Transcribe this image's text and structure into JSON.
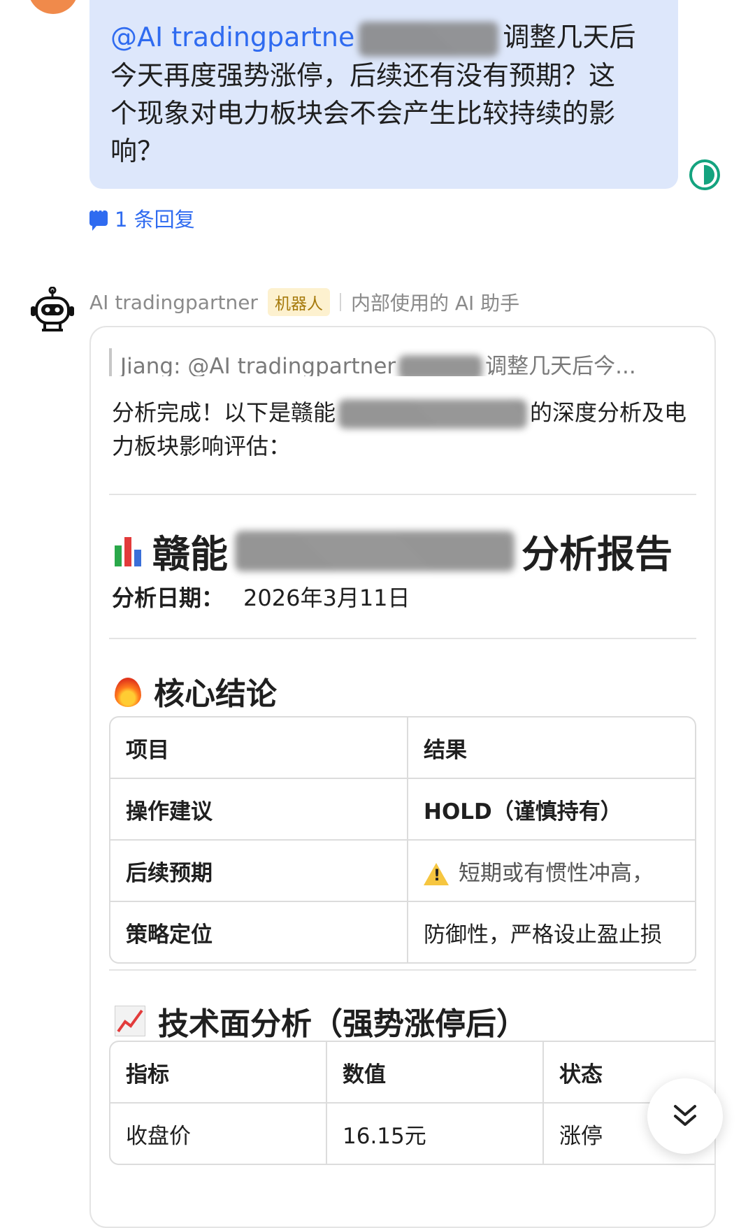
{
  "user_message": {
    "mention": "@AI tradingpartne",
    "line1_tail": "调整几天后",
    "line2": "今天再度强势涨停，后续还有没有预期？这",
    "line3": "个现象对电力板块会不会产生比较持续的影",
    "line4": "响？",
    "reply_count_label": "1 条回复"
  },
  "bot": {
    "name": "AI tradingpartner",
    "tag": "机器人",
    "description": "内部使用的 AI 助手"
  },
  "reply": {
    "quote_prefix": "Jiang: @AI tradingpartner",
    "quote_tail": "调整几天后今...",
    "intro_start": "分析完成！以下是赣能",
    "intro_tail": "的深度分析及电",
    "intro_line2": "力板块影响评估：",
    "report_title_start": "赣能",
    "report_title_end": "分析报告",
    "date_label": "分析日期：",
    "date_value": "2026年3月11日",
    "section1_title": "核心结论",
    "table1": {
      "headers": [
        "项目",
        "结果"
      ],
      "rows": [
        [
          "操作建议",
          "HOLD（谨慎持有）"
        ],
        [
          "后续预期",
          "短期或有惯性冲高，"
        ],
        [
          "策略定位",
          "防御性，严格设止盈止损"
        ]
      ]
    },
    "section2_title": "技术面分析（强势涨停后）",
    "table2": {
      "headers": [
        "指标",
        "数值",
        "状态"
      ],
      "rows": [
        [
          "收盘价",
          "16.15元",
          "涨停"
        ]
      ]
    }
  },
  "colors": {
    "bubble_bg": "#dde7fb",
    "link": "#2f6bf0",
    "tag_bg": "#fdf1cf",
    "tag_text": "#a67a0c",
    "status_green": "#14a37f"
  },
  "icons": {
    "scroll_down": "double-chevron-down-icon",
    "bot": "robot-icon",
    "section1": "fire-icon",
    "section2": "chart-increasing-icon",
    "report": "bar-chart-icon"
  }
}
